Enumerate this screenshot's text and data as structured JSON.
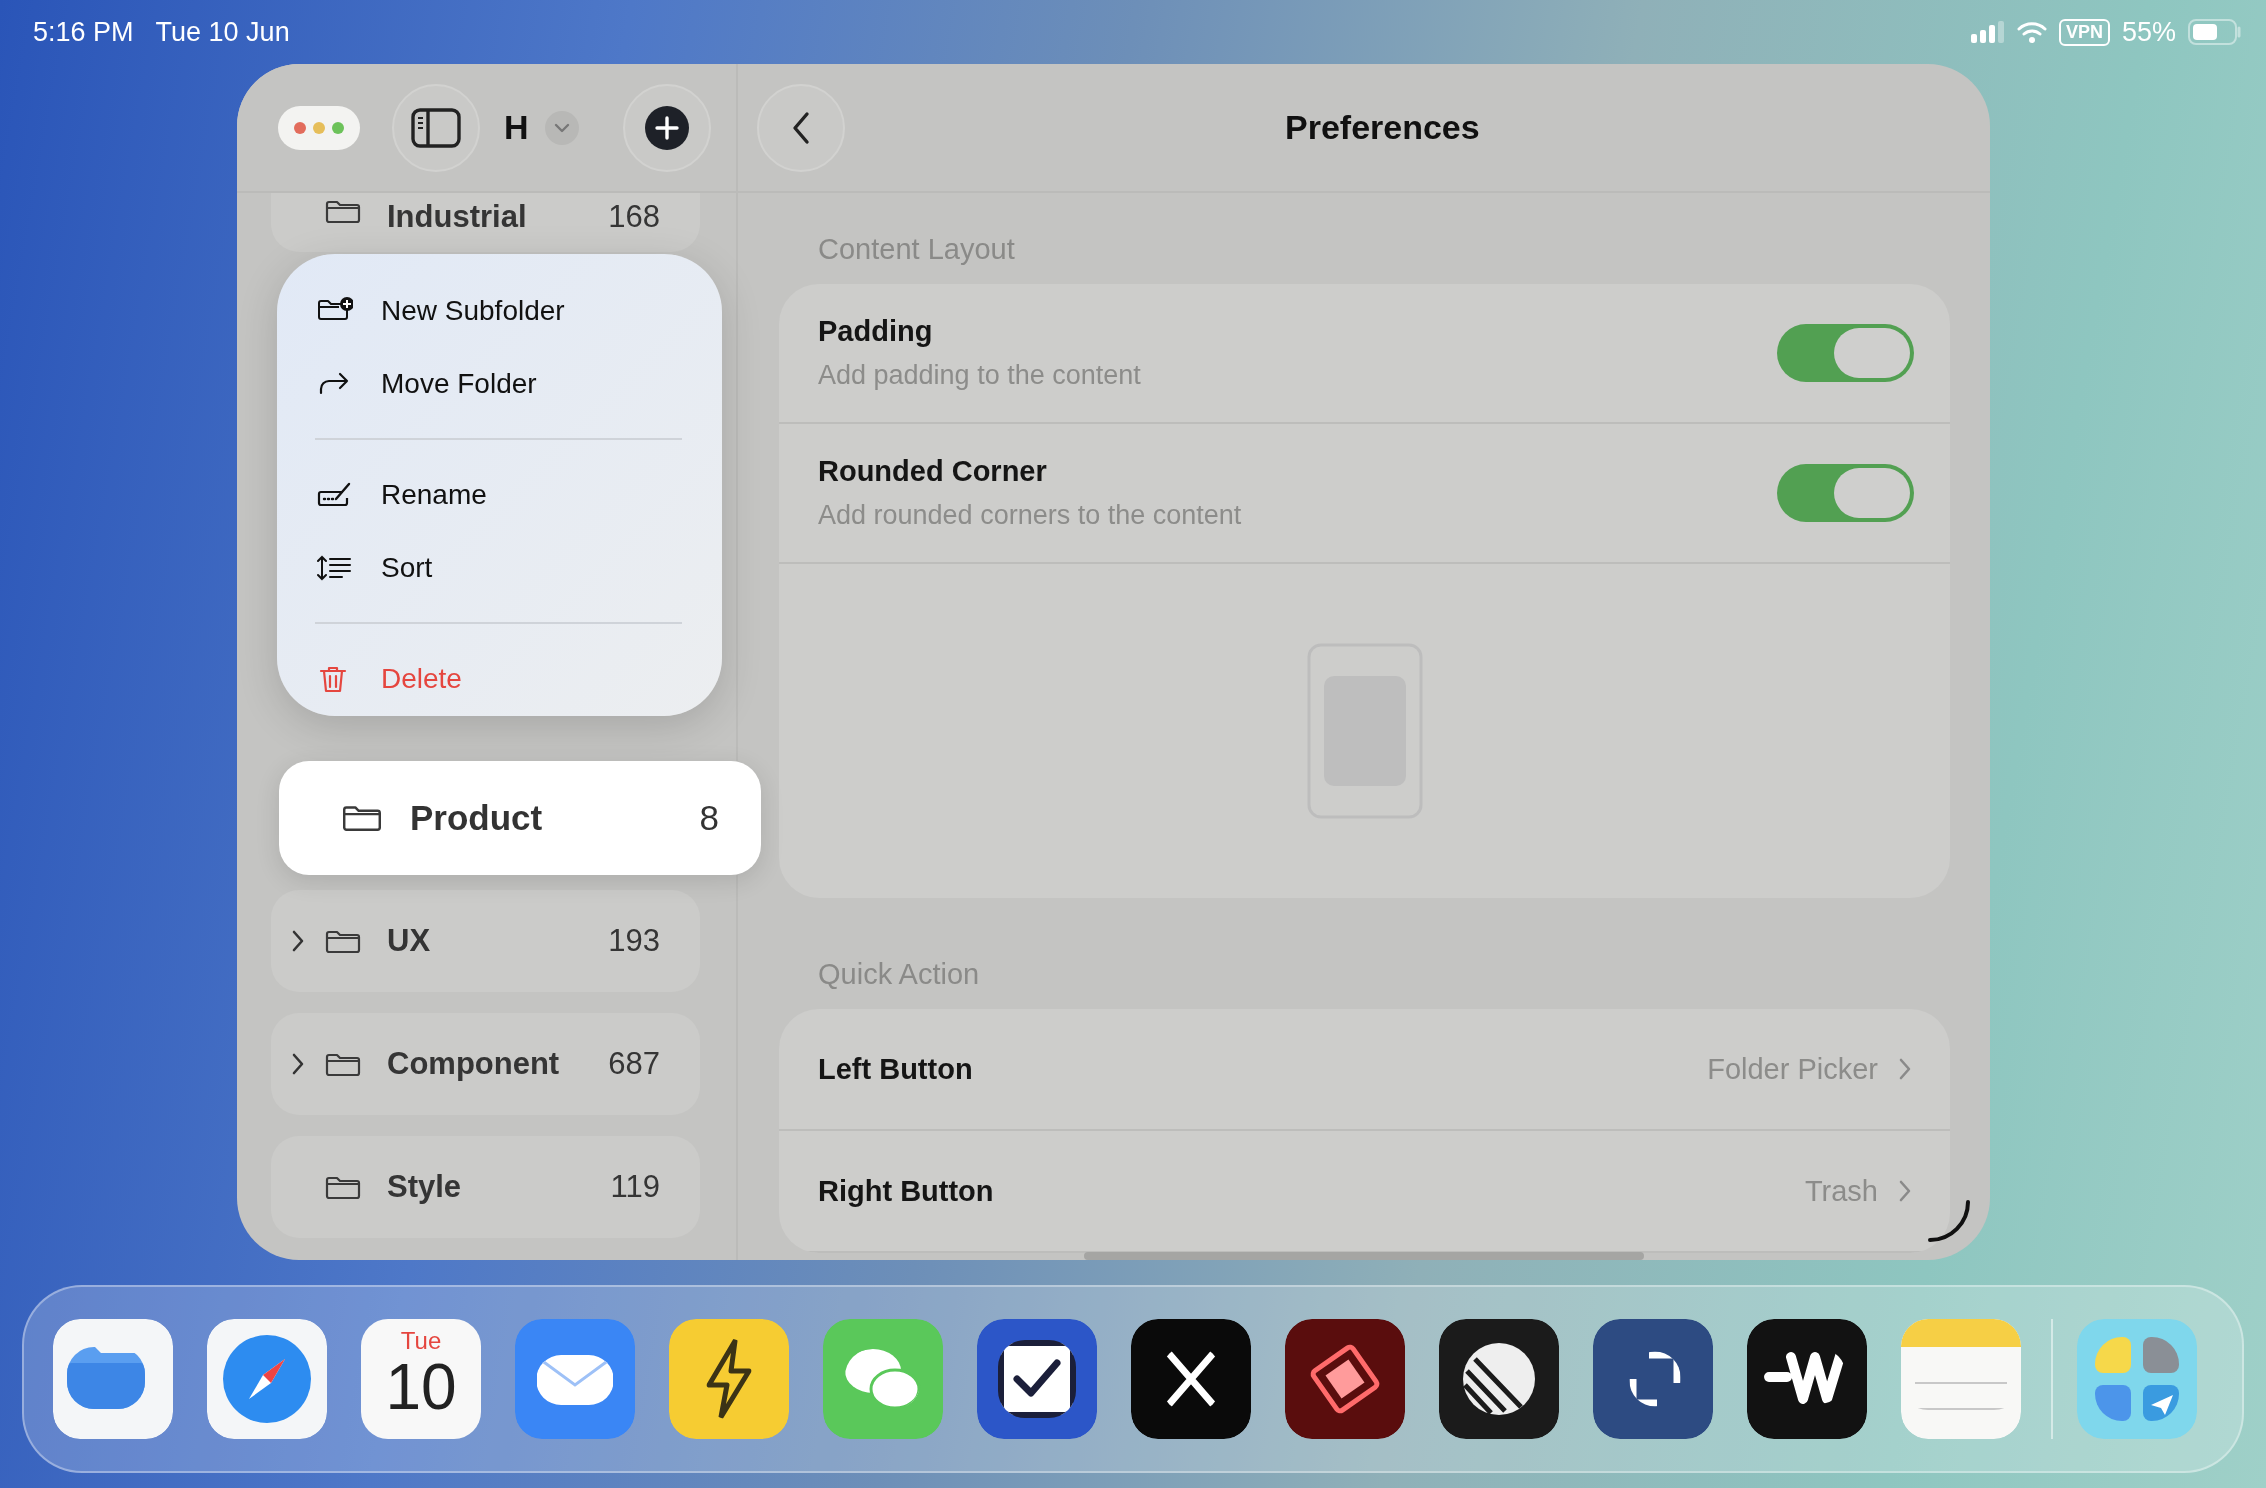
{
  "status_bar": {
    "time": "5:16 PM",
    "date": "Tue 10 Jun",
    "vpn": "VPN",
    "battery": "55%"
  },
  "toolbar": {
    "library_initial": "H",
    "title": "Preferences"
  },
  "sidebar": {
    "items": [
      {
        "name": "Industrial",
        "count": "168",
        "has_children": false,
        "partial": true
      },
      {
        "name": "UX",
        "count": "193",
        "has_children": true,
        "partial": false
      },
      {
        "name": "Component",
        "count": "687",
        "has_children": true,
        "partial": false
      },
      {
        "name": "Style",
        "count": "119",
        "has_children": false,
        "partial": false
      }
    ]
  },
  "context_menu": {
    "groups": [
      [
        {
          "label": "New Subfolder",
          "kind": "new-folder",
          "destructive": false
        },
        {
          "label": "Move Folder",
          "kind": "move",
          "destructive": false
        }
      ],
      [
        {
          "label": "Rename",
          "kind": "rename",
          "destructive": false
        },
        {
          "label": "Sort",
          "kind": "sort",
          "destructive": false
        }
      ],
      [
        {
          "label": "Delete",
          "kind": "trash",
          "destructive": true
        }
      ]
    ]
  },
  "dragged_item": {
    "name": "Product",
    "count": "8"
  },
  "sections": [
    {
      "title": "Content Layout",
      "rows": [
        {
          "kind": "toggle",
          "title": "Padding",
          "subtitle": "Add padding to the content",
          "on": true
        },
        {
          "kind": "toggle",
          "title": "Rounded Corner",
          "subtitle": "Add rounded corners to the content",
          "on": true
        },
        {
          "kind": "preview"
        }
      ]
    },
    {
      "title": "Quick Action",
      "rows": [
        {
          "kind": "link",
          "title": "Left Button",
          "value": "Folder Picker"
        },
        {
          "kind": "link",
          "title": "Right Button",
          "value": "Trash"
        }
      ]
    }
  ],
  "dock": {
    "apps": [
      {
        "kind": "folder"
      },
      {
        "kind": "compass"
      },
      {
        "kind": "calendar",
        "day": "Tue",
        "date": "10"
      },
      {
        "kind": "mail"
      },
      {
        "kind": "bolt"
      },
      {
        "kind": "chat"
      },
      {
        "kind": "check"
      },
      {
        "kind": "cross"
      },
      {
        "kind": "layers"
      },
      {
        "kind": "sphere"
      },
      {
        "kind": "expand"
      },
      {
        "kind": "zigzag"
      },
      {
        "kind": "notes"
      }
    ],
    "stack": {
      "kind": "app-folder"
    }
  }
}
